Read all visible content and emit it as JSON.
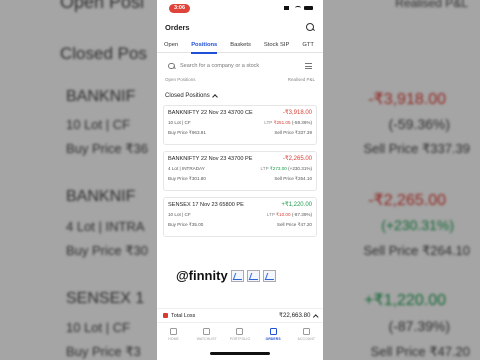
{
  "status_bar": {
    "time": "3:06"
  },
  "header": {
    "title": "Orders"
  },
  "tabs": [
    "Open",
    "Positions",
    "Baskets",
    "Stock SIP",
    "GTT"
  ],
  "active_tab": "Positions",
  "search": {
    "placeholder": "Search for a company or a stock"
  },
  "cut_off_row": {
    "left": "Open Positions",
    "right": "Realised P&L"
  },
  "closed_positions": {
    "heading": "Closed Positions",
    "items": [
      {
        "symbol": "BANKNIFTY 22 Nov 23 43700 CE",
        "pnl": "-₹3,918.00",
        "pnl_status": "negative",
        "lot_info": "10 Lot | CF",
        "ltp_label": "LTP",
        "ltp": "₹251.05",
        "change_pct": "(-59.36%)",
        "buy_price": "Buy Price ₹963.91",
        "sell_price": "Sell Price ₹337.39"
      },
      {
        "symbol": "BANKNIFTY 22 Nov 23 43700 PE",
        "pnl": "-₹2,265.00",
        "pnl_status": "negative",
        "lot_info": "4 Lot | INTRADAY",
        "ltp_label": "LTP",
        "ltp": "₹273.00",
        "change_pct": "(+230.31%)",
        "buy_price": "Buy Price ₹301.80",
        "sell_price": "Sell Price ₹264.10"
      },
      {
        "symbol": "SENSEX 17 Nov 23 65800 PE",
        "pnl": "+₹1,220.00",
        "pnl_status": "positive",
        "lot_info": "10 Lot | CF",
        "ltp_label": "LTP",
        "ltp": "₹10.00",
        "change_pct": "(-87.39%)",
        "buy_price": "Buy Price ₹35.00",
        "sell_price": "Sell Price ₹47.20"
      }
    ]
  },
  "watermark": "@finnity",
  "total": {
    "label": "Total Loss",
    "value": "₹22,663.80"
  },
  "bottom_nav": [
    "HOME",
    "WATCHLIST",
    "PORTFOLIO",
    "ORDERS",
    "ACCOUNT"
  ],
  "bottom_nav_active": "ORDERS",
  "background": {
    "left": [
      "Open Posi",
      "Closed Pos",
      "BANKNIF",
      "10 Lot | CF",
      "Buy Price ₹36",
      "BANKNIF",
      "4 Lot | INTRA",
      "Buy Price ₹30",
      "SENSEX 1",
      "10 Lot | CF",
      "Buy Price ₹3"
    ],
    "right": [
      "Realised P&L",
      "-₹3,918.00",
      "(-59.36%)",
      "Sell Price ₹337.39",
      "-₹2,265.00",
      "(+230.31%)",
      "Sell Price ₹264.10",
      "+₹1,220.00",
      "(-87.39%)",
      "Sell Price ₹47.20"
    ]
  },
  "colors": {
    "accent": "#1e4fd6",
    "negative": "#d63b32",
    "positive": "#1c9a4d",
    "status_pill": "#e0433a"
  }
}
